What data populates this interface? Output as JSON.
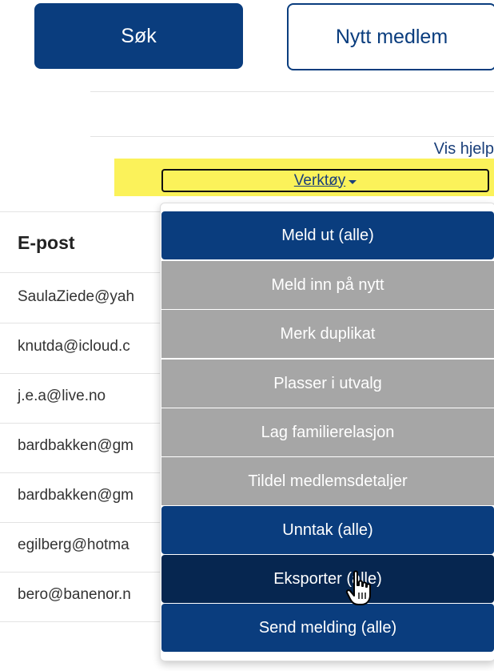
{
  "header": {
    "search_label": "Søk",
    "new_member_label": "Nytt medlem",
    "help_link": "Vis hjelp"
  },
  "tools": {
    "label": "Verktøy"
  },
  "table": {
    "column_email": "E-post",
    "rows": [
      "SaulaZiede@yah",
      "knutda@icloud.c",
      "j.e.a@live.no",
      "bardbakken@gm",
      "bardbakken@gm",
      "egilberg@hotma",
      "bero@banenor.n"
    ]
  },
  "menu": {
    "items": [
      {
        "label": "Meld ut (alle)",
        "state": "enabled"
      },
      {
        "label": "Meld inn på nytt",
        "state": "disabled"
      },
      {
        "label": "Merk duplikat",
        "state": "disabled"
      },
      {
        "label": "Plasser i utvalg",
        "state": "disabled"
      },
      {
        "label": "Lag familierelasjon",
        "state": "disabled"
      },
      {
        "label": "Tildel medlemsdetaljer",
        "state": "disabled"
      },
      {
        "label": "Unntak (alle)",
        "state": "enabled"
      },
      {
        "label": "Eksporter (alle)",
        "state": "hovered"
      },
      {
        "label": "Send melding (alle)",
        "state": "enabled"
      }
    ]
  },
  "colors": {
    "primary": "#0a3d7e",
    "hover": "#062650",
    "disabled": "#a6a6a6",
    "highlight": "#fbf25a"
  },
  "icons": {
    "caret": "caret-down-icon",
    "cursor": "hand-pointer-icon"
  }
}
